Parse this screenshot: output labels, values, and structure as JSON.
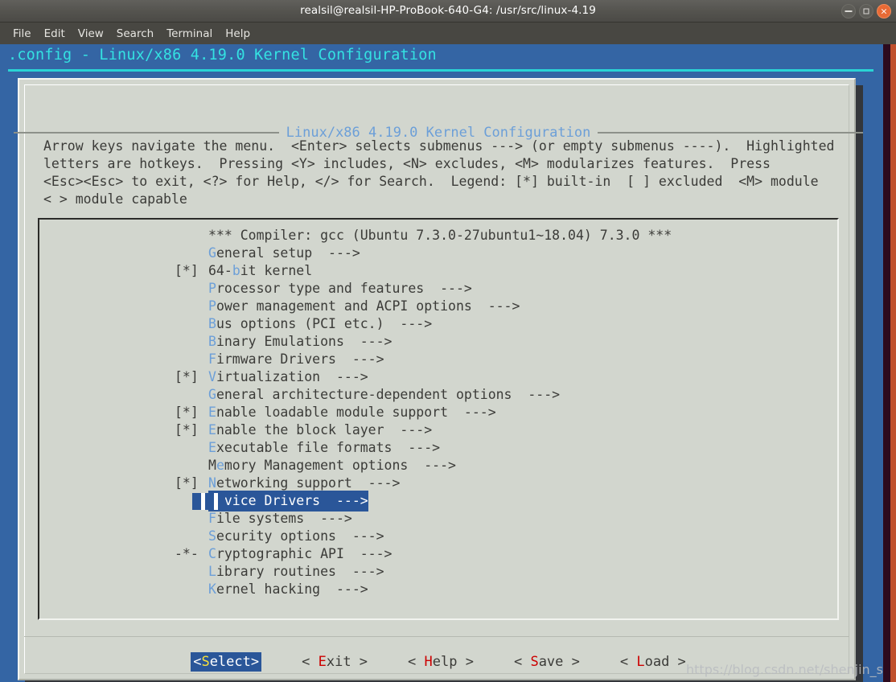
{
  "window": {
    "title": "realsil@realsil-HP-ProBook-640-G4: /usr/src/linux-4.19",
    "controls": {
      "minimize": "minimize-button",
      "maximize": "maximize-button",
      "close": "×"
    }
  },
  "menubar": {
    "items": [
      {
        "label": "File"
      },
      {
        "label": "Edit"
      },
      {
        "label": "View"
      },
      {
        "label": "Search"
      },
      {
        "label": "Terminal"
      },
      {
        "label": "Help"
      }
    ]
  },
  "terminal": {
    "heading": ".config - Linux/x86 4.19.0 Kernel Configuration"
  },
  "dialog": {
    "title": "Linux/x86 4.19.0 Kernel Configuration",
    "help_text": "Arrow keys navigate the menu.  <Enter> selects submenus ---> (or empty submenus ----).  Highlighted\nletters are hotkeys.  Pressing <Y> includes, <N> excludes, <M> modularizes features.  Press\n<Esc><Esc> to exit, <?> for Help, </> for Search.  Legend: [*] built-in  [ ] excluded  <M> module\n< > module capable",
    "menu_items": [
      {
        "mark": "",
        "hot": "",
        "pre": "*** Compiler: gcc (Ubuntu 7.3.0-27ubuntu1~18.04) 7.3.0 ***",
        "post": "",
        "selected": false
      },
      {
        "mark": "",
        "hot": "G",
        "pre": "",
        "post": "eneral setup  --->",
        "selected": false
      },
      {
        "mark": "[*]",
        "hot": "b",
        "pre": "64-",
        "post": "it kernel",
        "selected": false
      },
      {
        "mark": "",
        "hot": "P",
        "pre": "",
        "post": "rocessor type and features  --->",
        "selected": false
      },
      {
        "mark": "",
        "hot": "P",
        "pre": "",
        "post": "ower management and ACPI options  --->",
        "selected": false
      },
      {
        "mark": "",
        "hot": "B",
        "pre": "",
        "post": "us options (PCI etc.)  --->",
        "selected": false
      },
      {
        "mark": "",
        "hot": "B",
        "pre": "",
        "post": "inary Emulations  --->",
        "selected": false
      },
      {
        "mark": "",
        "hot": "F",
        "pre": "",
        "post": "irmware Drivers  --->",
        "selected": false
      },
      {
        "mark": "[*]",
        "hot": "V",
        "pre": "",
        "post": "irtualization  --->",
        "selected": false
      },
      {
        "mark": "",
        "hot": "G",
        "pre": "",
        "post": "eneral architecture-dependent options  --->",
        "selected": false
      },
      {
        "mark": "[*]",
        "hot": "E",
        "pre": "",
        "post": "nable loadable module support  --->",
        "selected": false
      },
      {
        "mark": "[*]",
        "hot": "E",
        "pre": "",
        "post": "nable the block layer  --->",
        "selected": false
      },
      {
        "mark": "",
        "hot": "E",
        "pre": "",
        "post": "xecutable file formats  --->",
        "selected": false
      },
      {
        "mark": "",
        "hot": "e",
        "pre": "M",
        "post": "mory Management options  --->",
        "selected": false
      },
      {
        "mark": "[*]",
        "hot": "N",
        "pre": "",
        "post": "etworking support  --->",
        "selected": false
      },
      {
        "mark": "",
        "hot": "D",
        "pre": "",
        "post": "evice Drivers  --->",
        "selected": true
      },
      {
        "mark": "",
        "hot": "F",
        "pre": "",
        "post": "ile systems  --->",
        "selected": false
      },
      {
        "mark": "",
        "hot": "S",
        "pre": "",
        "post": "ecurity options  --->",
        "selected": false
      },
      {
        "mark": "-*-",
        "hot": "C",
        "pre": "",
        "post": "ryptographic API  --->",
        "selected": false
      },
      {
        "mark": "",
        "hot": "L",
        "pre": "",
        "post": "ibrary routines  --->",
        "selected": false
      },
      {
        "mark": "",
        "hot": "K",
        "pre": "",
        "post": "ernel hacking  --->",
        "selected": false
      }
    ],
    "buttons": [
      {
        "left": "<",
        "hk": "S",
        "right": "elect>",
        "active": true
      },
      {
        "left": "< ",
        "hk": "E",
        "right": "xit >",
        "active": false
      },
      {
        "left": "< ",
        "hk": "H",
        "right": "elp >",
        "active": false
      },
      {
        "left": "< ",
        "hk": "S",
        "right": "ave >",
        "active": false
      },
      {
        "left": "< ",
        "hk": "L",
        "right": "oad >",
        "active": false
      }
    ]
  },
  "watermark": {
    "text": "https://blog.csdn.net/shenjin_s"
  },
  "colors": {
    "terminal_bg": "#3465a4",
    "dialog_bg": "#d2d6ce",
    "heading_cyan": "#34e2e2",
    "hotkey_blue": "#6c9fd8",
    "hotkey_yellow": "#f7e03c",
    "hotkey_red": "#cc0000",
    "selection_blue": "#2a5699",
    "frame_orange": "#c0502d"
  }
}
